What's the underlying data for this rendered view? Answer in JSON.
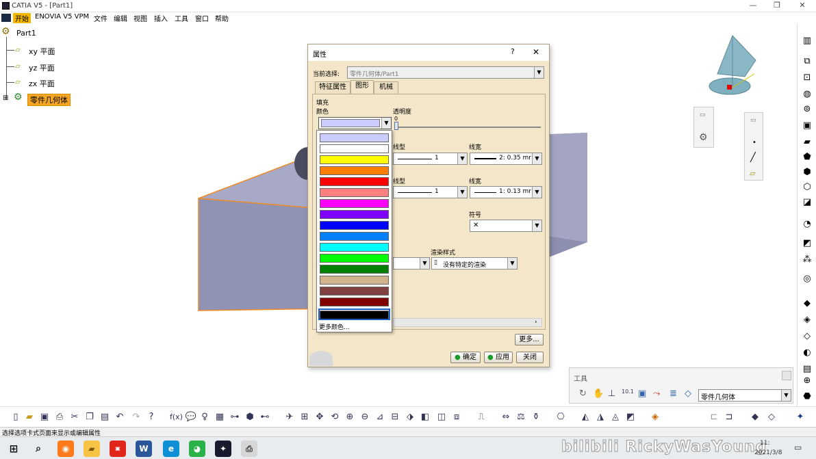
{
  "window": {
    "title": "CATIA V5 - [Part1]",
    "minimize": "—",
    "maximize": "❐",
    "close": "✕"
  },
  "menu": {
    "items": [
      "开始",
      "ENOVIA V5 VPM",
      "文件",
      "编辑",
      "视图",
      "插入",
      "工具",
      "窗口",
      "帮助"
    ]
  },
  "tree": {
    "root": "Part1",
    "planes": [
      "xy 平面",
      "yz 平面",
      "zx 平面"
    ],
    "body": "零件几何体"
  },
  "dialog": {
    "title": "属性",
    "help": "?",
    "close": "✕",
    "current_selection_label": "当前选择:",
    "current_selection_value": "零件几何体/Part1",
    "tabs": [
      "特征属性",
      "图形",
      "机械"
    ],
    "fill_label": "填充",
    "color_label": "颜色",
    "transparency_label": "透明度",
    "transparency_value": "0",
    "linetype_label": "线型",
    "linewidth_label": "线宽",
    "edges": [
      {
        "linetype": "1",
        "linewidth": "2: 0.35 mr"
      },
      {
        "linetype": "1",
        "linewidth": "1: 0.13 mr"
      }
    ],
    "symbol_label": "符号",
    "symbol_value": "✕",
    "render_label": "渲染样式",
    "render_value": "没有特定的渲染",
    "more_button": "更多...",
    "ok_button": "确定",
    "apply_button": "应用",
    "close_button": "关闭"
  },
  "palette": {
    "colors": [
      "#ccccff",
      "#ffffff",
      "#ffff00",
      "#ff8000",
      "#ff0000",
      "#ff8080",
      "#ff00ff",
      "#8000ff",
      "#0000ff",
      "#0080ff",
      "#00ffff",
      "#00ff00",
      "#008000",
      "#d2b48c",
      "#804040",
      "#800000",
      "#000000"
    ],
    "more_colors": "更多颜色..."
  },
  "tools_panel": {
    "title": "工具",
    "body_value": "零件几何体"
  },
  "status": {
    "text": "选择选项卡式页面来显示或编辑属性"
  },
  "taskbar": {
    "date": "2021/3/8",
    "time": "11:"
  },
  "watermark": "bilibili RickyWasYoung",
  "colors": {
    "accent": "#f5a623",
    "dialog_bg": "#f4e6c9"
  }
}
